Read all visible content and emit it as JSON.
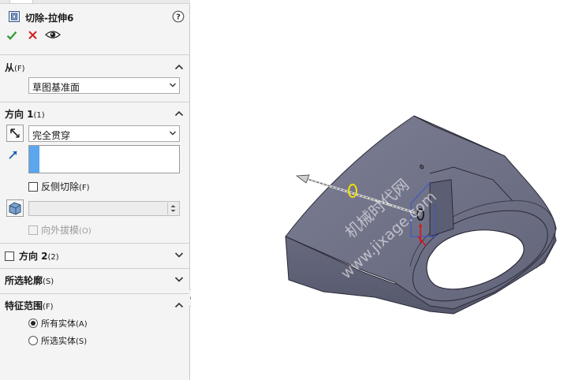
{
  "feature": {
    "title": "切除-拉伸6",
    "help_label": "?"
  },
  "actions": {
    "ok_icon": "check-icon",
    "cancel_icon": "close-icon",
    "preview_icon": "eye-icon"
  },
  "from_section": {
    "title": "从",
    "hint": "(F)",
    "select_value": "草图基准面"
  },
  "direction1": {
    "title": "方向 1",
    "hint": "(1)",
    "end_condition": "完全贯穿",
    "flip_side_label": "反侧切除",
    "flip_side_hint": "(F)",
    "flip_side_checked": false,
    "draft_outward_label": "向外拔模",
    "draft_outward_hint": "(O)",
    "draft_outward_enabled": false
  },
  "direction2": {
    "title": "方向 2",
    "hint": "(2)",
    "checked": false
  },
  "selected_contours": {
    "title": "所选轮廓",
    "hint": "(S)"
  },
  "feature_scope": {
    "title": "特征范围",
    "hint": "(F)",
    "options": [
      {
        "label": "所有实体",
        "hint": "(A)",
        "selected": true
      },
      {
        "label": "所选实体",
        "hint": "(S)",
        "selected": false
      }
    ]
  },
  "watermark": {
    "line1": "机械时代网",
    "line2": "www.jixage.com"
  },
  "colors": {
    "panel_bg": "#f4f4f4",
    "accent_blue": "#5aa7f0",
    "ok_green": "#2e9a2e",
    "cancel_red": "#d42020",
    "model_face": "#6f7186",
    "highlight_yellow": "#f2e000"
  }
}
